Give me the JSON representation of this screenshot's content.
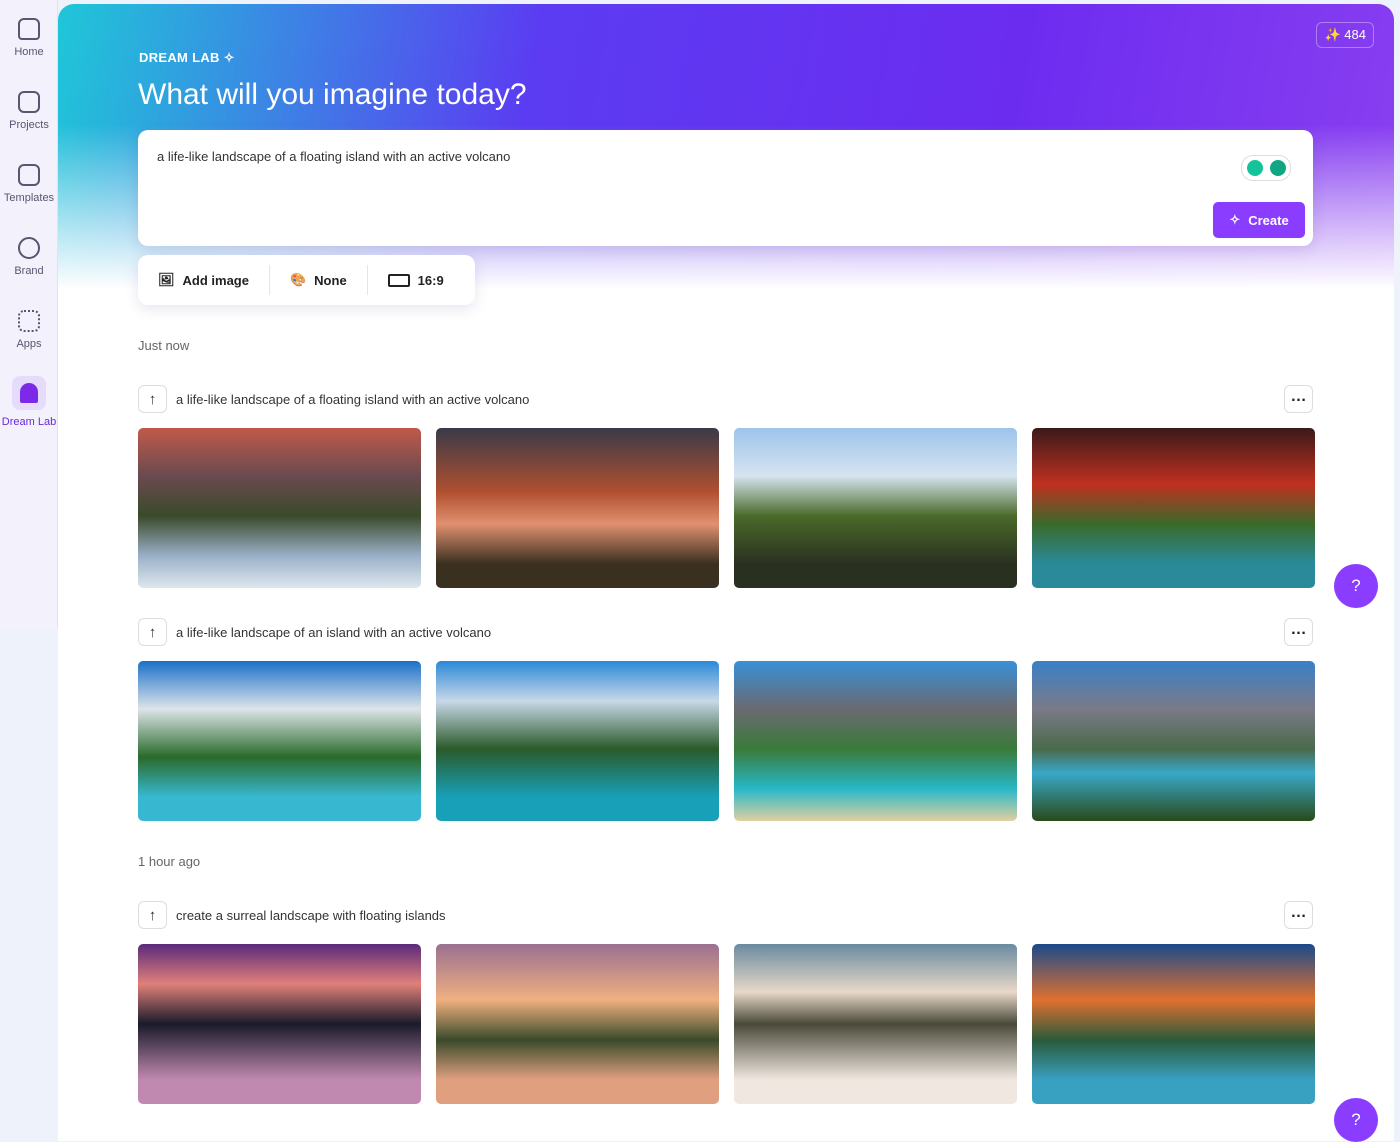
{
  "sidebar": {
    "items": [
      {
        "label": "Home",
        "icon": "home-icon"
      },
      {
        "label": "Projects",
        "icon": "folder-icon"
      },
      {
        "label": "Templates",
        "icon": "templates-icon"
      },
      {
        "label": "Brand",
        "icon": "brand-icon"
      },
      {
        "label": "Apps",
        "icon": "apps-icon"
      },
      {
        "label": "Dream Lab",
        "icon": "dream-lab-icon",
        "active": true
      }
    ]
  },
  "header": {
    "eyebrow": "DREAM LAB",
    "title": "What will you imagine today?",
    "credits": "484"
  },
  "prompt": {
    "value": "a life-like landscape of a floating island with an active volcano",
    "create_label": "Create"
  },
  "options": {
    "add_image": "Add image",
    "style": "None",
    "aspect": "16:9"
  },
  "groups": [
    {
      "time": "Just now",
      "rows": [
        {
          "prompt": "a life-like landscape of a floating island with an active volcano",
          "images": [
            "Floating island with erupting volcano above clouds at sunset",
            "Floating island with volcano over sea at dusk",
            "Floating island with waterfalls and volcano",
            "Floating island with volcano over turquoise bay"
          ]
        },
        {
          "prompt": "a life-like landscape of an island with an active volcano",
          "images": [
            "Tropical beach with volcano plume",
            "Waterfalls and lagoon with volcano",
            "Palm beach with smoking volcano",
            "Coastline with volcano and ash cloud"
          ]
        }
      ]
    },
    {
      "time": "1 hour ago",
      "rows": [
        {
          "prompt": "create a surreal landscape with floating islands",
          "images": [
            "Purple sky with dark floating islands",
            "Sunset floating islands",
            "Floating islands above clouds with waterfalls",
            "Colorful swirling sky with floating islands"
          ]
        }
      ]
    }
  ],
  "colors": {
    "accent": "#8b3dff"
  }
}
